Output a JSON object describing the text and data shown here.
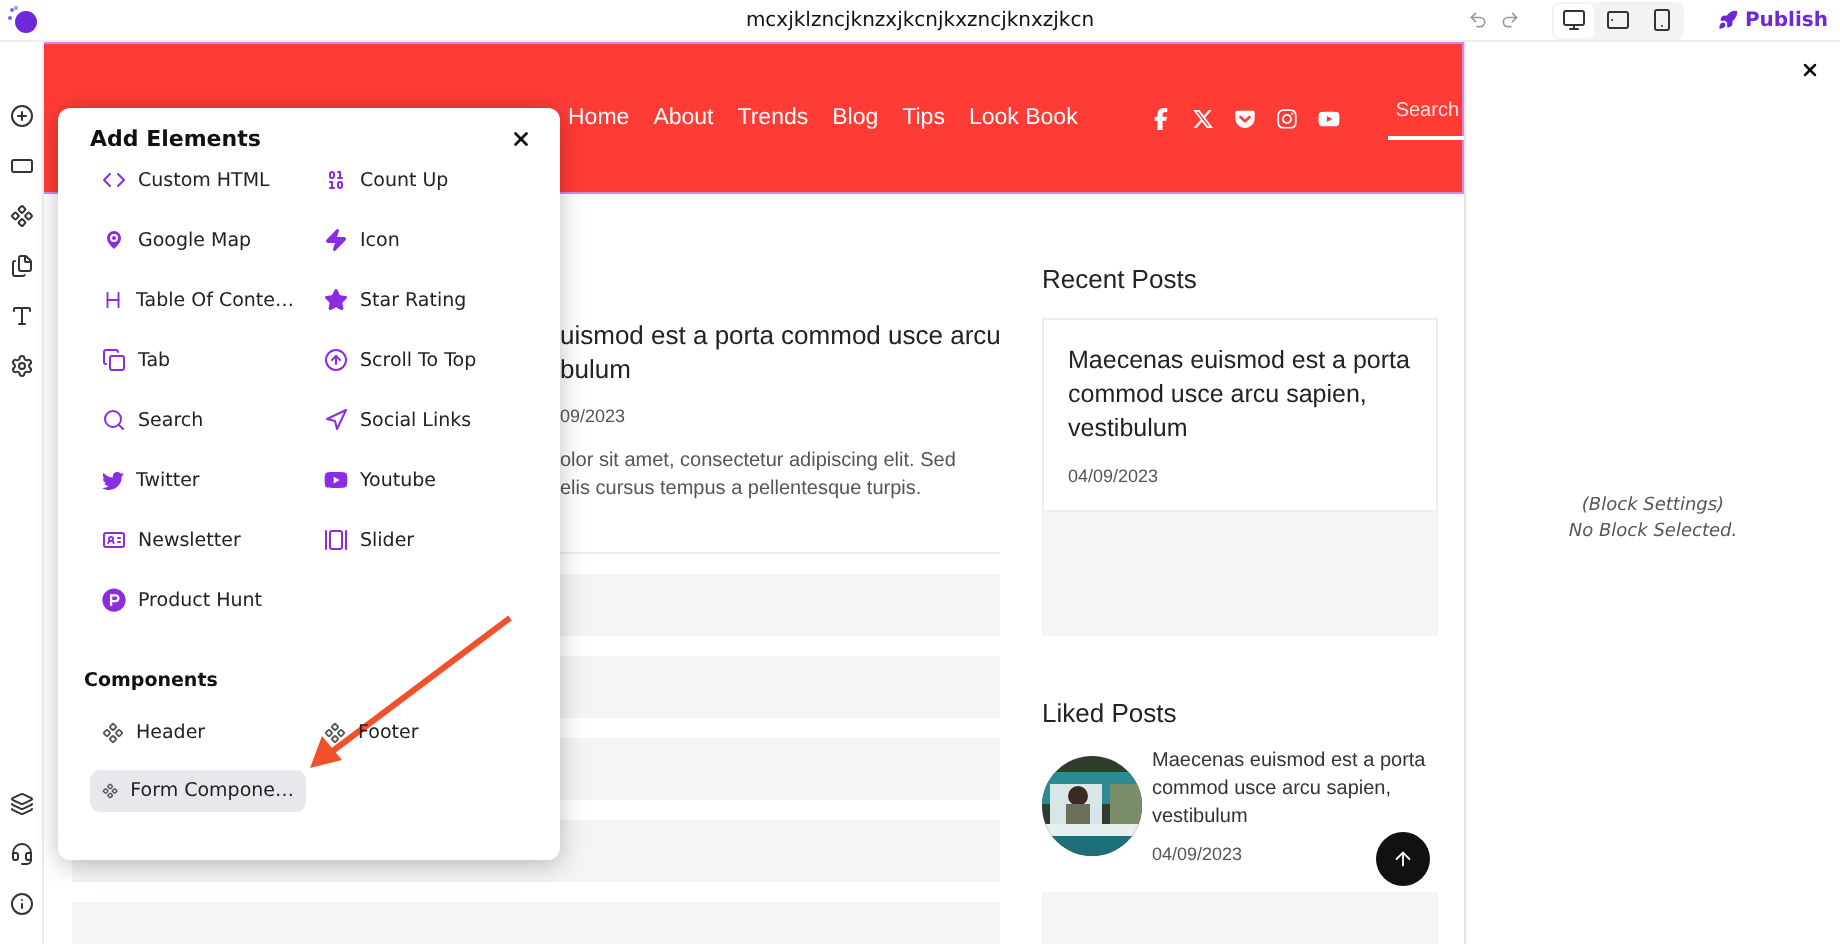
{
  "topbar": {
    "title": "mcxjklzncjknzxjkcnjkxzncjknxzjkcn",
    "devices": [
      {
        "selected": true
      },
      {
        "selected": false
      },
      {
        "selected": false
      }
    ],
    "publish": "Publish"
  },
  "site_header": {
    "nav": [
      "Home",
      "About",
      "Trends",
      "Blog",
      "Tips",
      "Look Book"
    ],
    "search": {
      "placeholder": "Search"
    }
  },
  "article": {
    "title_lines": [
      "uismod est a porta commod usce arcu",
      "bulum"
    ],
    "date": "09/2023",
    "excerpt_lines": [
      "olor sit amet, consectetur adipiscing elit. Sed",
      "elis cursus tempus a pellentesque turpis."
    ]
  },
  "sidebar": {
    "recent_heading": "Recent Posts",
    "recent_post": {
      "title": "Maecenas euismod est a porta commod usce arcu sapien, vestibulum",
      "date": "04/09/2023"
    },
    "liked_heading": "Liked Posts",
    "liked_post": {
      "title": "Maecenas euismod est a porta commod usce arcu sapien, vestibulum",
      "date": "04/09/2023"
    }
  },
  "popup": {
    "title": "Add Elements",
    "elements": [
      "Custom HTML",
      "Count Up",
      "Google Map",
      "Icon",
      "Table Of Conte…",
      "Star Rating",
      "Tab",
      "Scroll To Top",
      "Search",
      "Social Links",
      "Twitter",
      "Youtube",
      "Newsletter",
      "Slider",
      "Product Hunt"
    ],
    "components_heading": "Components",
    "components": [
      {
        "label": "Header",
        "selected": false
      },
      {
        "label": "Footer",
        "selected": false
      },
      {
        "label": "Form Compone…",
        "selected": true
      }
    ]
  },
  "settings_panel": {
    "heading": "(Block Settings)",
    "message": "No Block Selected."
  }
}
